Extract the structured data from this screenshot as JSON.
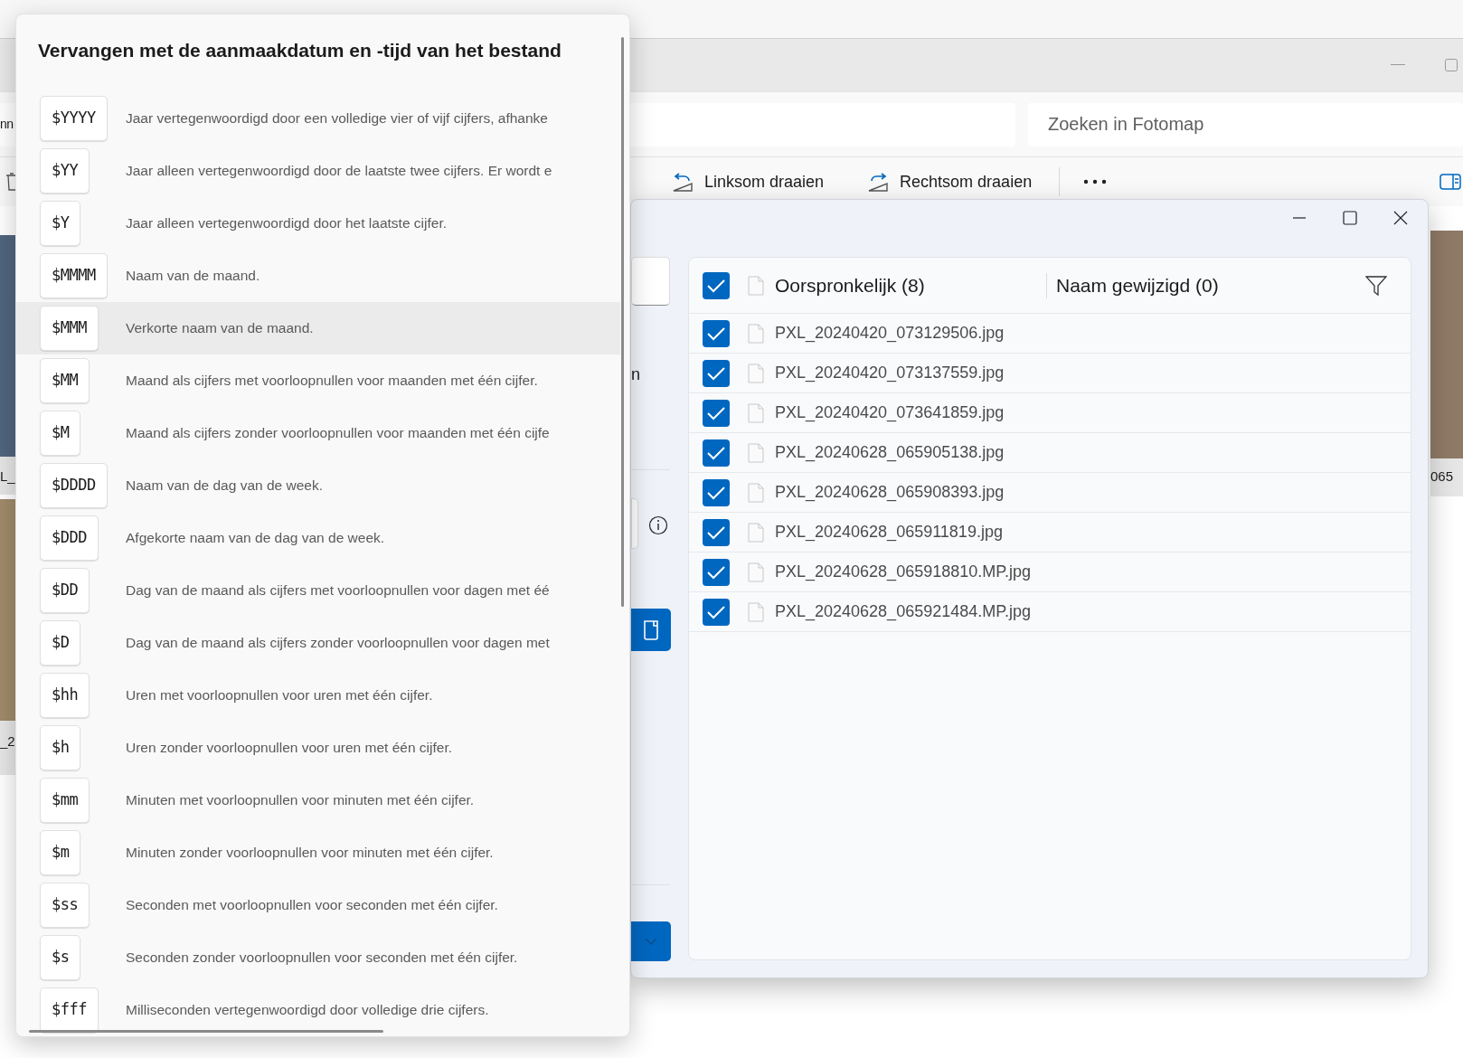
{
  "explorer": {
    "address_fragment": "nn",
    "search": {
      "placeholder": "Zoeken in Fotomap"
    },
    "toolbar": [
      {
        "label": "Linksom draaien",
        "kind": "rotate-left"
      },
      {
        "label": "Rechtsom draaien",
        "kind": "rotate-right"
      }
    ],
    "thumbnail_captions": [
      "L_",
      "_2",
      "065"
    ]
  },
  "rename_dialog": {
    "left_fragment": "n",
    "list": {
      "header": {
        "checked": true,
        "original": "Oorspronkelijk (8)",
        "renamed": "Naam gewijzigd (0)"
      },
      "rows": [
        {
          "name": "PXL_20240420_073129506.jpg",
          "checked": true
        },
        {
          "name": "PXL_20240420_073137559.jpg",
          "checked": true
        },
        {
          "name": "PXL_20240420_073641859.jpg",
          "checked": true
        },
        {
          "name": "PXL_20240628_065905138.jpg",
          "checked": true
        },
        {
          "name": "PXL_20240628_065908393.jpg",
          "checked": true
        },
        {
          "name": "PXL_20240628_065911819.jpg",
          "checked": true
        },
        {
          "name": "PXL_20240628_065918810.MP.jpg",
          "checked": true
        },
        {
          "name": "PXL_20240628_065921484.MP.jpg",
          "checked": true
        }
      ]
    }
  },
  "flyout": {
    "title": "Vervangen met de aanmaakdatum en -tijd van het bestand",
    "items": [
      {
        "code": "$YYYY",
        "description": "Jaar vertegenwoordigd door een volledige vier of vijf cijfers, afhanke",
        "hovered": false
      },
      {
        "code": "$YY",
        "description": "Jaar alleen vertegenwoordigd door de laatste twee cijfers. Er wordt e",
        "hovered": false
      },
      {
        "code": "$Y",
        "description": "Jaar alleen vertegenwoordigd door het laatste cijfer.",
        "hovered": false
      },
      {
        "code": "$MMMM",
        "description": "Naam van de maand.",
        "hovered": false
      },
      {
        "code": "$MMM",
        "description": "Verkorte naam van de maand.",
        "hovered": true
      },
      {
        "code": "$MM",
        "description": "Maand als cijfers met voorloopnullen voor maanden met één cijfer.",
        "hovered": false
      },
      {
        "code": "$M",
        "description": "Maand als cijfers zonder voorloopnullen voor maanden met één cijfe",
        "hovered": false
      },
      {
        "code": "$DDDD",
        "description": "Naam van de dag van de week.",
        "hovered": false
      },
      {
        "code": "$DDD",
        "description": "Afgekorte naam van de dag van de week.",
        "hovered": false
      },
      {
        "code": "$DD",
        "description": "Dag van de maand als cijfers met voorloopnullen voor dagen met éé",
        "hovered": false
      },
      {
        "code": "$D",
        "description": "Dag van de maand als cijfers zonder voorloopnullen voor dagen met",
        "hovered": false
      },
      {
        "code": "$hh",
        "description": "Uren met voorloopnullen voor uren met één cijfer.",
        "hovered": false
      },
      {
        "code": "$h",
        "description": "Uren zonder voorloopnullen voor uren met één cijfer.",
        "hovered": false
      },
      {
        "code": "$mm",
        "description": "Minuten met voorloopnullen voor minuten met één cijfer.",
        "hovered": false
      },
      {
        "code": "$m",
        "description": "Minuten zonder voorloopnullen voor minuten met één cijfer.",
        "hovered": false
      },
      {
        "code": "$ss",
        "description": "Seconden met voorloopnullen voor seconden met één cijfer.",
        "hovered": false
      },
      {
        "code": "$s",
        "description": "Seconden zonder voorloopnullen voor seconden met één cijfer.",
        "hovered": false
      },
      {
        "code": "$fff",
        "description": "Milliseconden vertegenwoordigd door volledige drie cijfers.",
        "hovered": false
      }
    ]
  }
}
